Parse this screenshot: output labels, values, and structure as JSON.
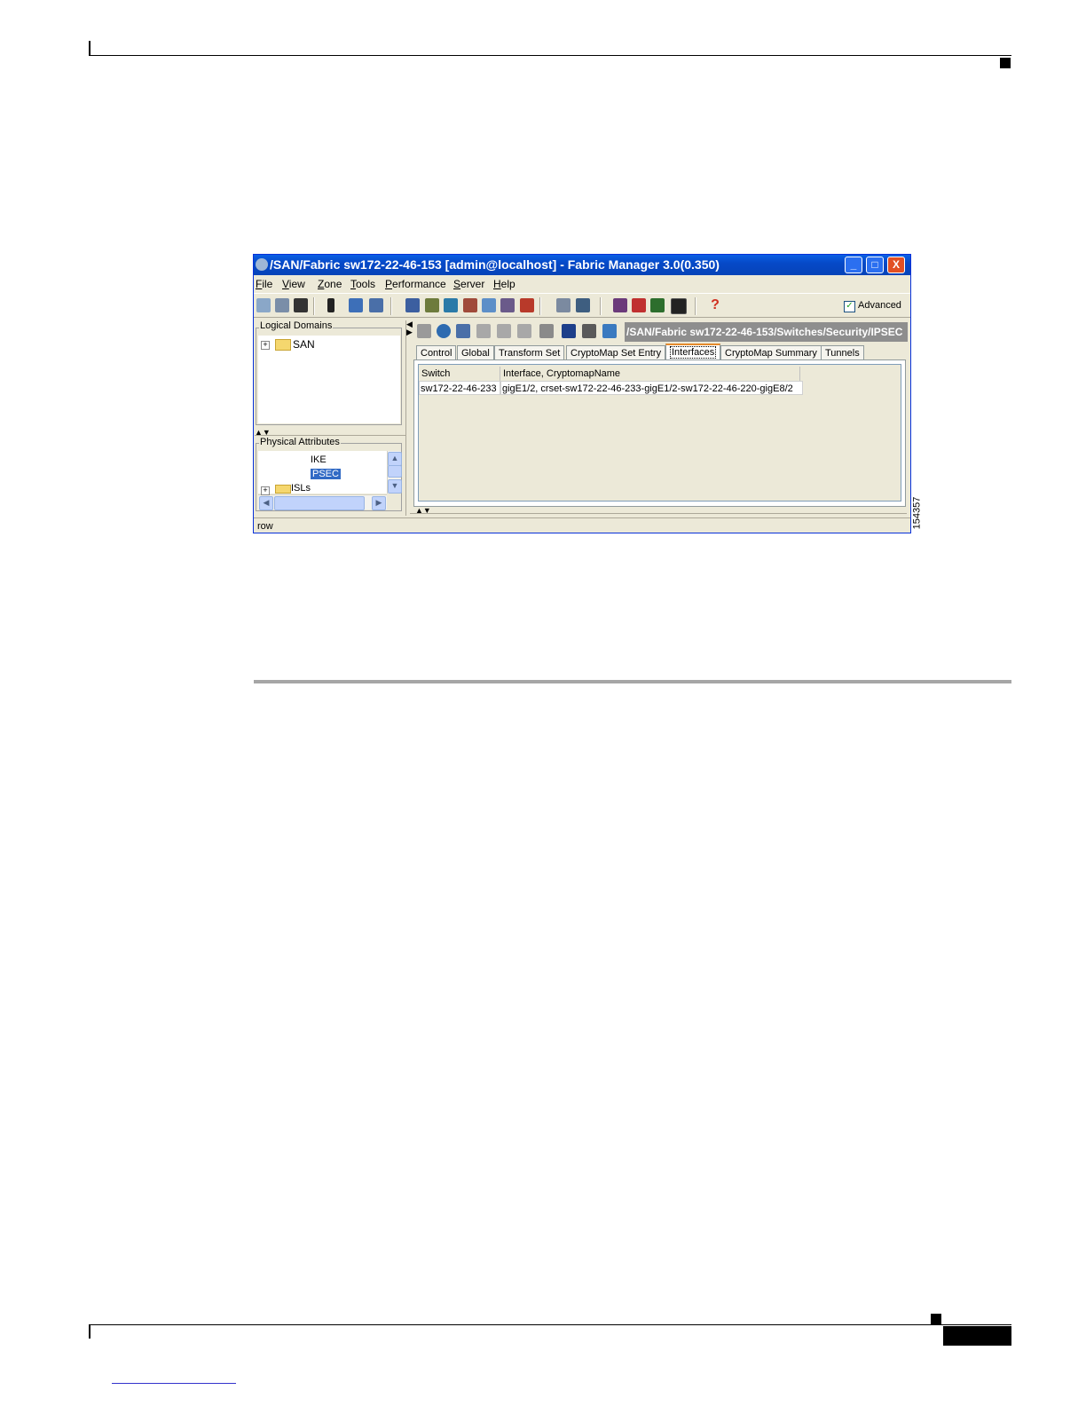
{
  "window": {
    "title": "/SAN/Fabric sw172-22-46-153 [admin@localhost] - Fabric Manager 3.0(0.350)",
    "controls": {
      "minimize": "_",
      "maximize": "□",
      "close": "X"
    }
  },
  "menubar": [
    "File",
    "View",
    "Zone",
    "Tools",
    "Performance",
    "Server",
    "Help"
  ],
  "toolbar": {
    "advanced_label": "Advanced",
    "advanced_checked": true
  },
  "logical_domains": {
    "legend": "Logical Domains",
    "items": [
      {
        "label": "SAN",
        "expander": "+"
      }
    ]
  },
  "physical_attributes": {
    "legend": "Physical Attributes",
    "items": [
      {
        "label": "IKE"
      },
      {
        "label": "PSEC",
        "selected": true
      },
      {
        "label": "ISLs",
        "expander": "+"
      }
    ]
  },
  "path_bar": "/SAN/Fabric sw172-22-46-153/Switches/Security/IPSEC",
  "tabs": [
    {
      "label": "Control"
    },
    {
      "label": "Global"
    },
    {
      "label": "Transform Set"
    },
    {
      "label": "CryptoMap Set Entry"
    },
    {
      "label": "Interfaces",
      "active": true
    },
    {
      "label": "CryptoMap Summary"
    },
    {
      "label": "Tunnels"
    }
  ],
  "table": {
    "columns": [
      "Switch",
      "Interface, CryptomapName"
    ],
    "rows": [
      [
        "sw172-22-46-233",
        "gigE1/2, crset-sw172-22-46-233-gigE1/2-sw172-22-46-220-gigE8/2"
      ]
    ]
  },
  "status_text": "row",
  "figure_id": "154357",
  "colors": {
    "titlebar": "#0a5fe4",
    "window_bg": "#ece9d8",
    "selection": "#316ac5",
    "active_tab_accent": "#e68b2c",
    "path_bar_bg": "#8e8e8e"
  }
}
